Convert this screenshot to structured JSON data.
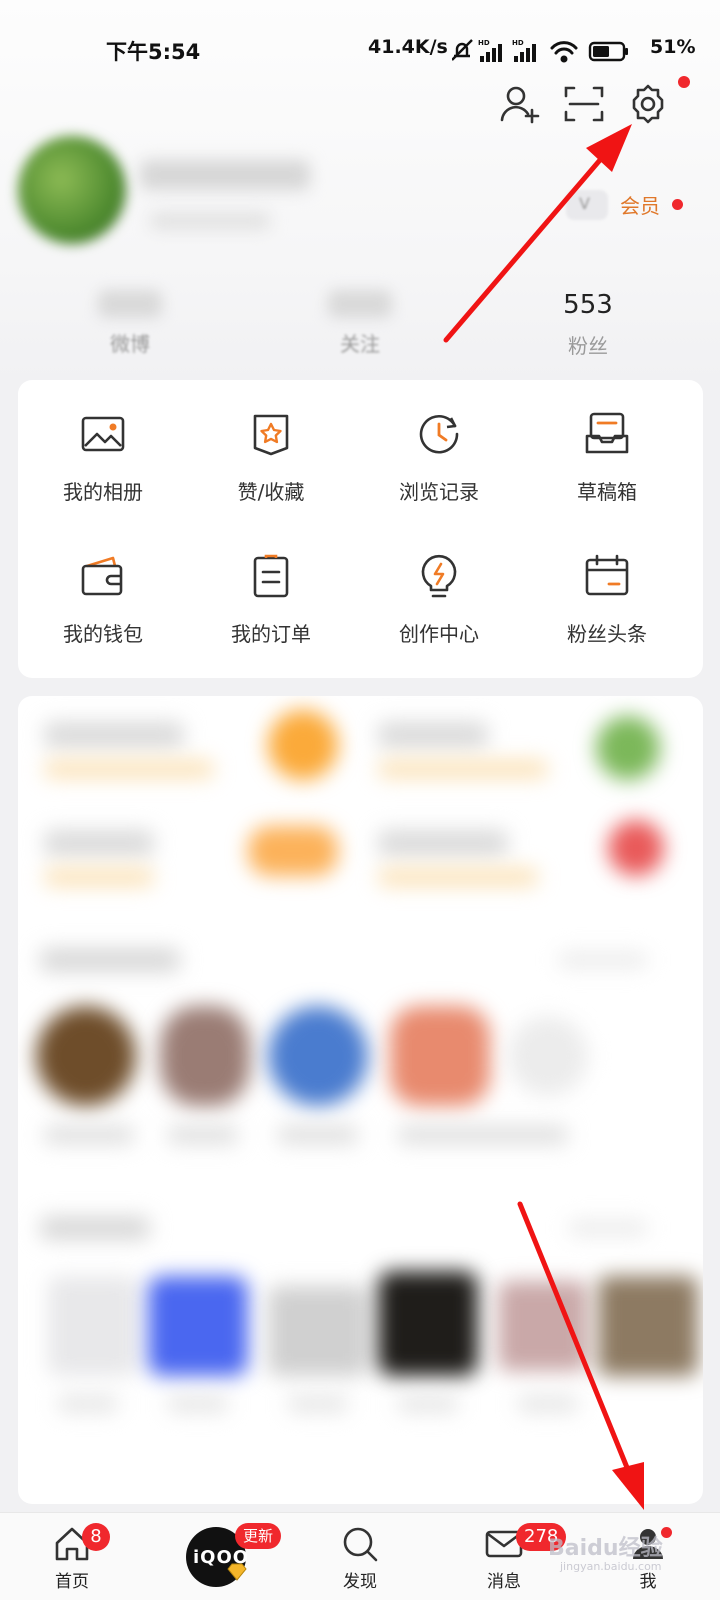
{
  "status_bar": {
    "time": "下午5:54",
    "net_speed": "41.4K/s",
    "battery_percent": "51%"
  },
  "top_actions": [
    {
      "icon": "add-friend-icon"
    },
    {
      "icon": "scan-icon"
    },
    {
      "icon": "settings-icon"
    }
  ],
  "profile": {
    "vip_label": "会员",
    "vip_badge": "V"
  },
  "stats": [
    {
      "label": "微博",
      "value": ""
    },
    {
      "label": "关注",
      "value": ""
    },
    {
      "label": "粉丝",
      "value": "553"
    }
  ],
  "menu": [
    {
      "label": "我的相册",
      "icon": "photo-album-icon"
    },
    {
      "label": "赞/收藏",
      "icon": "favorites-icon"
    },
    {
      "label": "浏览记录",
      "icon": "history-icon"
    },
    {
      "label": "草稿箱",
      "icon": "drafts-icon"
    },
    {
      "label": "我的钱包",
      "icon": "wallet-icon"
    },
    {
      "label": "我的订单",
      "icon": "orders-icon"
    },
    {
      "label": "创作中心",
      "icon": "creator-center-icon"
    },
    {
      "label": "粉丝头条",
      "icon": "fan-headlines-icon"
    }
  ],
  "bottom_nav": {
    "home": {
      "label": "首页",
      "badge": "8"
    },
    "iqoo": {
      "logo_text": "iQOO",
      "badge": "更新"
    },
    "discover": {
      "label": "发现"
    },
    "messages": {
      "label": "消息",
      "badge": "278"
    },
    "me": {
      "label": "我"
    }
  },
  "watermark": {
    "text": "Baidu经验",
    "sub": "jingyan.baidu.com"
  },
  "colors": {
    "accent_orange": "#e0782a",
    "badge_red": "#f0282d",
    "icon_dark": "#333333"
  }
}
